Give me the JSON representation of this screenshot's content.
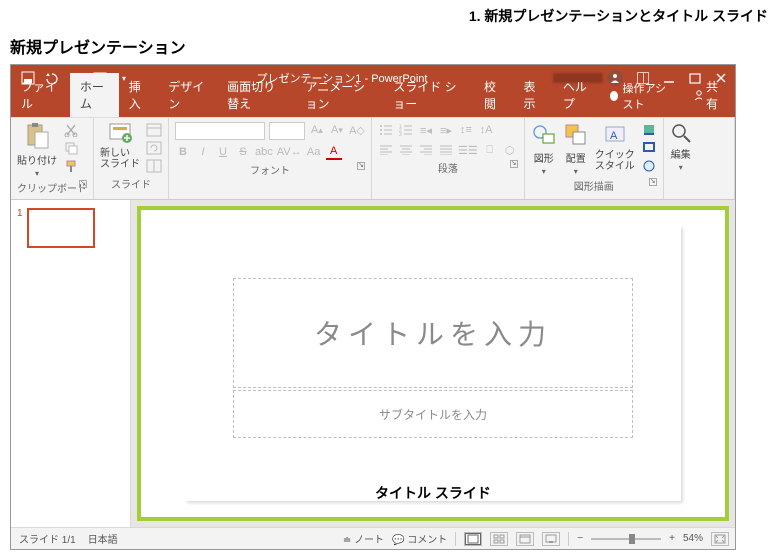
{
  "page": {
    "section_no": "1. 新規プレゼンテーションとタイトル スライド",
    "heading": "新規プレゼンテーション"
  },
  "titlebar": {
    "doc_title": "プレゼンテーション1 - PowerPoint"
  },
  "tabs": {
    "file": "ファイル",
    "home": "ホーム",
    "insert": "挿入",
    "design": "デザイン",
    "transition": "画面切り替え",
    "animation": "アニメーション",
    "slideshow": "スライド ショー",
    "review": "校閲",
    "view": "表示",
    "help": "ヘルプ",
    "tellme": "操作アシスト",
    "share": "共有"
  },
  "ribbon": {
    "clipboard": {
      "paste": "貼り付け",
      "label": "クリップボード"
    },
    "slides": {
      "newslide": "新しい\nスライド",
      "label": "スライド"
    },
    "font_label": "フォント",
    "para_label": "段落",
    "draw": {
      "shapes": "図形",
      "arrange": "配置",
      "quickstyle": "クイック\nスタイル",
      "label": "図形描画"
    },
    "edit": {
      "label": "編集"
    },
    "fmt": {
      "b": "B",
      "i": "I",
      "u": "U",
      "s": "S",
      "abc": "abc",
      "av": "AV",
      "aa": "Aa"
    }
  },
  "thumbs": {
    "num1": "1"
  },
  "slide": {
    "title_placeholder": "タイトルを入力",
    "subtitle_placeholder": "サブタイトルを入力",
    "caption": "タイトル スライド"
  },
  "status": {
    "pos": "スライド 1/1",
    "lang": "日本語",
    "notes": "ノート",
    "comments": "コメント",
    "zoom": "54%"
  }
}
